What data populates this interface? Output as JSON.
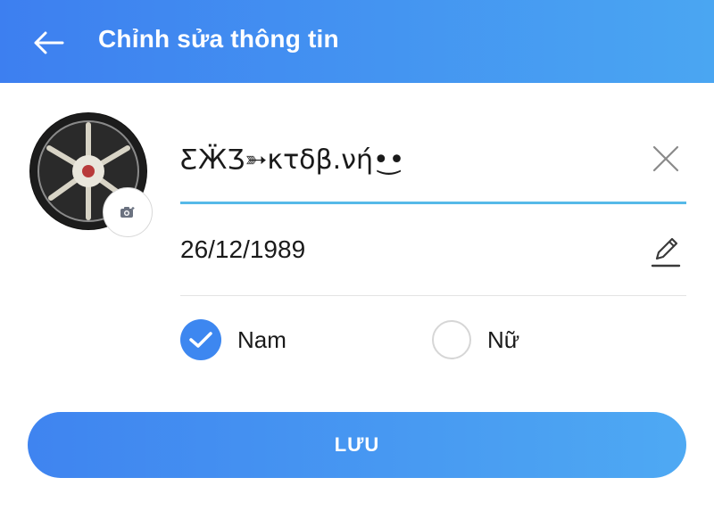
{
  "header": {
    "title": "Chỉnh sửa thông tin",
    "back_icon": "arrow-left-icon"
  },
  "profile": {
    "avatar_icon": "camera-icon",
    "name_value": "ƸӜƷ➳κτδβ.νή•͜•",
    "clear_icon": "close-icon",
    "dob_value": "26/12/1989",
    "edit_icon": "pencil-icon"
  },
  "gender": {
    "selected": "male",
    "options": [
      {
        "id": "male",
        "label": "Nam",
        "checked": true
      },
      {
        "id": "female",
        "label": "Nữ",
        "checked": false
      }
    ]
  },
  "actions": {
    "save_label": "LƯU"
  },
  "colors": {
    "header_gradient_start": "#3d7ff0",
    "header_gradient_end": "#4aa6f2",
    "accent": "#3d87f0",
    "underline": "#56b9e8"
  }
}
